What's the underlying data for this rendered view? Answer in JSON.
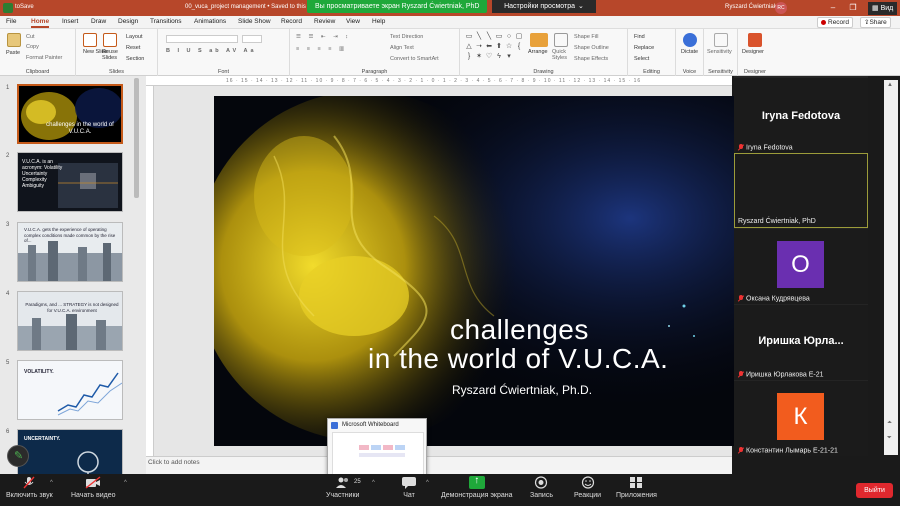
{
  "titlebar": {
    "autosave": "toSave",
    "document": "00_vuca_project management  •  Saved to this P",
    "username": "Ryszard Ćwiertniak",
    "avatar_initials": "RC"
  },
  "zoom_banner": {
    "sharing_text": "Вы просматриваете экран Ryszard Ćwiertniak, PhD",
    "view_options": "Настройки просмотра",
    "view_button": "Вид"
  },
  "menu": {
    "tabs": [
      "File",
      "Home",
      "Insert",
      "Draw",
      "Design",
      "Transitions",
      "Animations",
      "Slide Show",
      "Record",
      "Review",
      "View",
      "Help"
    ],
    "active": "Home",
    "record": "Record",
    "share": "Share"
  },
  "ribbon": {
    "clipboard": {
      "label": "Clipboard",
      "paste": "Paste",
      "cut": "Cut",
      "copy": "Copy",
      "format_painter": "Format Painter"
    },
    "slides": {
      "label": "Slides",
      "new_slide": "New Slide",
      "reuse_slides": "Reuse Slides",
      "layout": "Layout",
      "reset": "Reset",
      "section": "Section"
    },
    "font": {
      "label": "Font"
    },
    "paragraph": {
      "label": "Paragraph",
      "text_direction": "Text Direction",
      "align_text": "Align Text",
      "convert_smartart": "Convert to SmartArt"
    },
    "drawing": {
      "label": "Drawing",
      "arrange": "Arrange",
      "quick_styles": "Quick Styles",
      "shape_fill": "Shape Fill",
      "shape_outline": "Shape Outline",
      "shape_effects": "Shape Effects"
    },
    "editing": {
      "label": "Editing",
      "find": "Find",
      "replace": "Replace",
      "select": "Select"
    },
    "voice": {
      "label": "Voice",
      "dictate": "Dictate"
    },
    "sensitivity": {
      "label": "Sensitivity",
      "sensitivity": "Sensitivity"
    },
    "designer": {
      "label": "Designer",
      "designer": "Designer"
    }
  },
  "ruler_text": "16 · 15 · 14 · 13 · 12 · 11 · 10 · 9 · 8 · 7 · 6 · 5 · 4 · 3 · 2 · 1 · 0 · 1 · 2 · 3 · 4 · 5 · 6 · 7 · 8 · 9 · 10 · 11 · 12 · 13 · 14 · 15 · 16",
  "slides_panel": {
    "numbers": [
      "1",
      "2",
      "3",
      "4",
      "5",
      "6"
    ],
    "thumb1_text": "challenges in the world of V.U.C.A.",
    "thumb2_text": "V.U.C.A. is an acronym: Volatility Uncertainty Complexity Ambiguity",
    "thumb3_text": "V.U.C.A. gets the experience of operating complex conditions made common by the rise of...",
    "thumb4_text": "Paradigms, and ... STRATEGY is not designed for V.U.C.A. environment",
    "thumb5_text": "VOLATILITY.",
    "thumb6_text": "UNCERTAINTY."
  },
  "slide": {
    "line1": "challenges",
    "line2": "in the world of V.U.C.A.",
    "author": "Ryszard Ćwiertniak, Ph.D."
  },
  "notes_placeholder": "Click to add notes",
  "whiteboard": {
    "title": "Microsoft Whiteboard"
  },
  "participants": [
    {
      "big": "Iryna Fedotova",
      "name": "Iryna Fedotova"
    },
    {
      "big": "",
      "name": "Ryszard Ćwiertniak, PhD"
    },
    {
      "big": "О",
      "name": "Оксана Кудрявцева",
      "color": "#6a2fb0"
    },
    {
      "big": "Иришка  Юрла...",
      "name": "Иришка Юрлакова Е-21"
    },
    {
      "big": "К",
      "name": "Константин Лымарь Е-21-21",
      "color": "#f25c1e"
    }
  ],
  "zoombar": {
    "unmute": "Включить звук",
    "start_video": "Начать видео",
    "participants": "Участники",
    "participants_count": "25",
    "chat": "Чат",
    "share": "Демонстрация экрана",
    "record": "Запись",
    "reactions": "Реакции",
    "apps": "Приложения",
    "leave": "Выйти"
  }
}
